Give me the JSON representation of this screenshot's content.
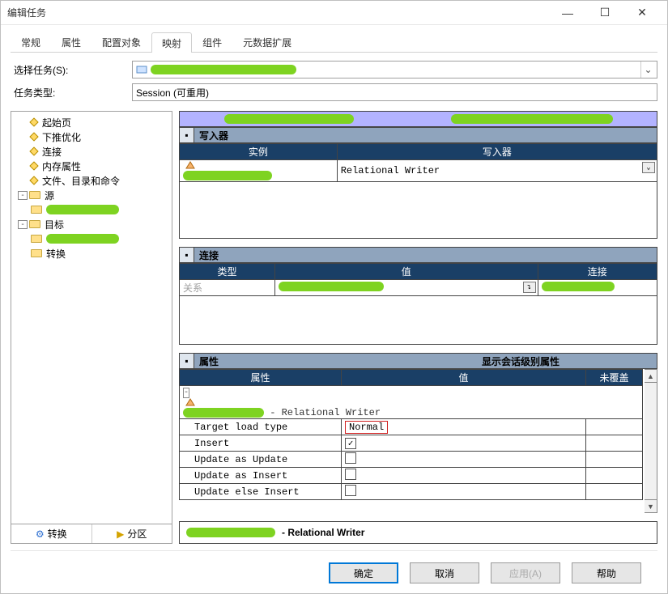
{
  "window": {
    "title": "编辑任务"
  },
  "tabs": [
    "常规",
    "属性",
    "配置对象",
    "映射",
    "组件",
    "元数据扩展"
  ],
  "active_tab_index": 3,
  "form": {
    "select_task_label": "选择任务(S):",
    "task_type_label": "任务类型:",
    "task_type_value": "Session (可重用)"
  },
  "tree": {
    "items": [
      {
        "type": "leaf",
        "indent": 1,
        "icon": "diamond",
        "label": "起始页"
      },
      {
        "type": "leaf",
        "indent": 1,
        "icon": "diamond",
        "label": "下推优化"
      },
      {
        "type": "leaf",
        "indent": 1,
        "icon": "diamond",
        "label": "连接"
      },
      {
        "type": "leaf",
        "indent": 1,
        "icon": "diamond",
        "label": "内存属性"
      },
      {
        "type": "leaf",
        "indent": 1,
        "icon": "diamond",
        "label": "文件、目录和命令"
      },
      {
        "type": "branch",
        "indent": 0,
        "icon": "folder",
        "label": "源",
        "twist": "-"
      },
      {
        "type": "redacted",
        "indent": 1
      },
      {
        "type": "branch",
        "indent": 0,
        "icon": "folder",
        "label": "目标",
        "twist": "-"
      },
      {
        "type": "redacted",
        "indent": 1
      },
      {
        "type": "leaf",
        "indent": 1,
        "icon": "folder",
        "label": "转换"
      }
    ],
    "bottom_tabs": [
      {
        "icon": "blue",
        "glyph": "⚙",
        "label": "转换"
      },
      {
        "icon": "yellow",
        "glyph": "▶",
        "label": "分区"
      }
    ]
  },
  "writers_panel": {
    "title": "写入器",
    "cols": [
      "实例",
      "写入器"
    ],
    "row": {
      "writer_value": "Relational Writer"
    }
  },
  "conn_panel": {
    "title": "连接",
    "cols": [
      "类型",
      "值",
      "连接"
    ],
    "row": {
      "type_value": "关系"
    }
  },
  "props_panel": {
    "title": "属性",
    "right_title": "显示会话级别属性",
    "cols": [
      "属性",
      "值",
      "未覆盖"
    ],
    "group_label": " - Relational Writer",
    "rows": [
      {
        "name": "Target load type",
        "value": "Normal",
        "kind": "text",
        "highlight": true
      },
      {
        "name": "Insert",
        "value": true,
        "kind": "checkbox"
      },
      {
        "name": "Update as Update",
        "value": false,
        "kind": "checkbox"
      },
      {
        "name": "Update as Insert",
        "value": false,
        "kind": "checkbox"
      },
      {
        "name": "Update else Insert",
        "value": false,
        "kind": "checkbox"
      }
    ]
  },
  "footer_bar": {
    "text": " - Relational Writer"
  },
  "buttons": {
    "ok": "确定",
    "cancel": "取消",
    "apply": "应用(A)",
    "help": "帮助"
  }
}
